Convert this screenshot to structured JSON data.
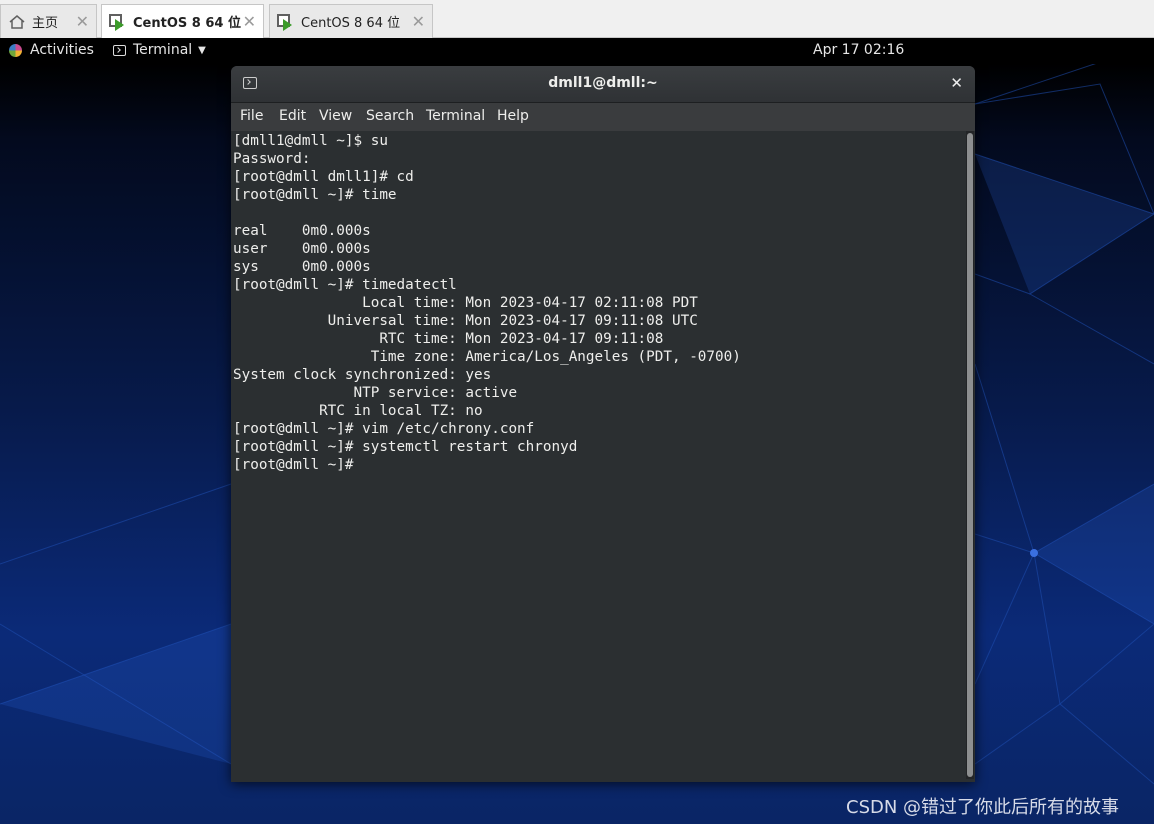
{
  "vm_tabs": [
    {
      "label": "主页",
      "icon": "home-icon",
      "active": false
    },
    {
      "label": "CentOS 8 64 位",
      "icon": "vm-icon",
      "active": true
    },
    {
      "label": "CentOS 8 64 位",
      "icon": "vm-icon",
      "active": false
    }
  ],
  "topbar": {
    "activities": "Activities",
    "app_menu": "Terminal",
    "clock": "Apr 17  02:16"
  },
  "window": {
    "title": "dmll1@dmll:~",
    "menu": [
      "File",
      "Edit",
      "View",
      "Search",
      "Terminal",
      "Help"
    ],
    "terminal_lines": [
      "[dmll1@dmll ~]$ su",
      "Password:",
      "[root@dmll dmll1]# cd",
      "[root@dmll ~]# time",
      "",
      "real    0m0.000s",
      "user    0m0.000s",
      "sys     0m0.000s",
      "[root@dmll ~]# timedatectl",
      "               Local time: Mon 2023-04-17 02:11:08 PDT",
      "           Universal time: Mon 2023-04-17 09:11:08 UTC",
      "                 RTC time: Mon 2023-04-17 09:11:08",
      "                Time zone: America/Los_Angeles (PDT, -0700)",
      "System clock synchronized: yes",
      "              NTP service: active",
      "          RTC in local TZ: no",
      "[root@dmll ~]# vim /etc/chrony.conf",
      "[root@dmll ~]# systemctl restart chronyd",
      "[root@dmll ~]#"
    ]
  },
  "watermark": "CSDN @错过了你此后所有的故事",
  "colors": {
    "terminal_bg": "#2b2f31",
    "terminal_fg": "#eeeeec",
    "topbar_bg": "#000000",
    "vm_play": "#3c9b2a"
  }
}
